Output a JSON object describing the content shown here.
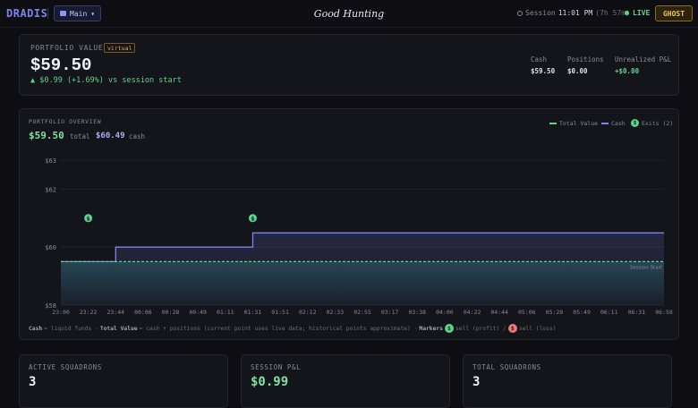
{
  "topbar": {
    "brand": "DRADIS",
    "separator": "|",
    "branch": "Main",
    "branch_caret": "▾",
    "title": "Good Hunting",
    "session_label": "Session",
    "session_time": "11:01 PM",
    "session_duration": "(7h 57m)",
    "live_label": "LIVE",
    "ghost_label": "GHOST"
  },
  "portfolio": {
    "label": "PORTFOLIO VALUE",
    "badge": "virtual",
    "value": "$59.50",
    "change": "▲ $0.99 (+1.69%) vs session start",
    "stats": [
      {
        "label": "Cash",
        "value": "$59.50"
      },
      {
        "label": "Positions",
        "value": "$0.00"
      },
      {
        "label": "Unrealized P&L",
        "value": "+$0.00"
      }
    ]
  },
  "overview": {
    "label": "PORTFOLIO OVERVIEW",
    "total_value": "$59.50",
    "total_label": "total",
    "cash_value": "$60.49",
    "cash_label": "cash",
    "legend": {
      "total": "Total Value",
      "cash": "Cash",
      "exits": "Exits (2)",
      "exit_marker": "$"
    },
    "footnote": {
      "cash_term": "Cash",
      "cash_def": "= liquid funds ·",
      "total_term": "Total Value",
      "total_def": "= cash + positions (current point uses live data; historical points approximate) ·",
      "markers_term": "Markers",
      "profit_marker": "$",
      "profit_text": "sell (profit) /",
      "loss_marker": "$",
      "loss_text": "sell (loss)"
    }
  },
  "chart_data": {
    "type": "line",
    "x": [
      "23:00",
      "23:22",
      "23:44",
      "00:06",
      "00:28",
      "00:49",
      "01:11",
      "01:31",
      "01:51",
      "02:12",
      "02:33",
      "02:55",
      "03:17",
      "03:38",
      "04:00",
      "04:22",
      "04:44",
      "05:06",
      "05:28",
      "05:49",
      "06:11",
      "06:31",
      "06:58"
    ],
    "ylim": [
      58,
      63
    ],
    "yticks": [
      58,
      60,
      62,
      63
    ],
    "ytick_labels": [
      "$58",
      "$60",
      "$62",
      "$63"
    ],
    "series": [
      {
        "name": "Total Value",
        "color": "#5fd38a",
        "style": "dashed",
        "values": [
          59.5,
          59.5,
          59.5,
          59.5,
          59.5,
          59.5,
          59.5,
          59.5,
          59.5,
          59.5,
          59.5,
          59.5,
          59.5,
          59.5,
          59.5,
          59.5,
          59.5,
          59.5,
          59.5,
          59.5,
          59.5,
          59.5,
          59.5
        ]
      },
      {
        "name": "Cash",
        "color": "#7c83f0",
        "style": "step",
        "values": [
          59.5,
          59.5,
          60.0,
          60.0,
          60.0,
          60.0,
          60.0,
          60.49,
          60.49,
          60.49,
          60.49,
          60.49,
          60.49,
          60.49,
          60.49,
          60.49,
          60.49,
          60.49,
          60.49,
          60.49,
          60.49,
          60.49,
          60.49
        ]
      }
    ],
    "exit_markers": [
      {
        "x": "23:22",
        "y": 61.0,
        "type": "profit",
        "label": "$"
      },
      {
        "x": "01:31",
        "y": 61.0,
        "type": "profit",
        "label": "$"
      }
    ],
    "reference_line": {
      "y": 59.5,
      "label": "Session Start"
    },
    "grid": true,
    "legend_position": "top-right"
  },
  "summary": [
    {
      "label": "ACTIVE SQUADRONS",
      "value": "3"
    },
    {
      "label": "SESSION P&L",
      "value": "$0.99"
    },
    {
      "label": "TOTAL SQUADRONS",
      "value": "3"
    }
  ]
}
